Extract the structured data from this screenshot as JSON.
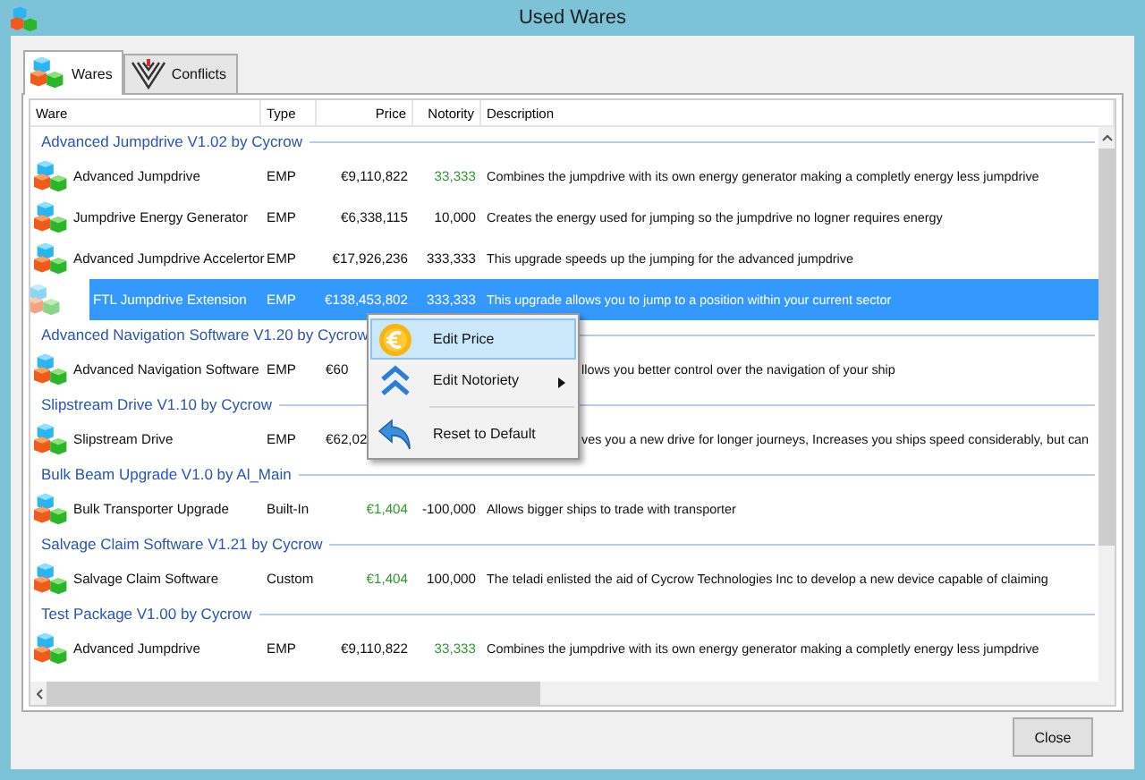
{
  "window": {
    "title": "Used Wares"
  },
  "tabs": [
    {
      "label": "Wares",
      "selected": true,
      "kind": "wares"
    },
    {
      "label": "Conflicts",
      "selected": false,
      "kind": "conflicts"
    }
  ],
  "table": {
    "columns": [
      "Ware",
      "Type",
      "Price",
      "Notority",
      "Description"
    ],
    "groups": [
      {
        "title": "Advanced Jumpdrive V1.02 by Cycrow",
        "rows": [
          {
            "ware": "Advanced Jumpdrive",
            "type": "EMP",
            "price": {
              "text": "€9,110,822"
            },
            "notoriety": {
              "text": "33,333",
              "color": "#2f9a2f"
            },
            "description": "Combines the jumpdrive with its own energy generator making a completly energy less jumpdrive",
            "selected": false
          },
          {
            "ware": "Jumpdrive Energy Generator",
            "type": "EMP",
            "price": {
              "text": "€6,338,115"
            },
            "notoriety": {
              "text": "10,000"
            },
            "description": "Creates the energy used for jumping so the jumpdrive no logner requires energy",
            "selected": false
          },
          {
            "ware": "Advanced Jumpdrive Accelertor",
            "type": "EMP",
            "price": {
              "text": "€17,926,236"
            },
            "notoriety": {
              "text": "333,333"
            },
            "description": "This upgrade speeds up the jumping for the advanced jumpdrive",
            "selected": false
          },
          {
            "ware": "FTL Jumpdrive Extension",
            "type": "EMP",
            "price": {
              "text": "€138,453,802"
            },
            "notoriety": {
              "text": "333,333"
            },
            "description": "This upgrade allows you to jump to a position within your current sector",
            "selected": true
          }
        ]
      },
      {
        "title": "Advanced Navigation Software V1.20 by Cycrow",
        "rows": [
          {
            "ware": "Advanced Navigation Software",
            "type": "EMP",
            "price": {
              "text": "€60"
            },
            "description": "llows you better control over the navigation of your ship",
            "selected": false
          }
        ]
      },
      {
        "title": "Slipstream Drive V1.10 by Cycrow",
        "rows": [
          {
            "ware": "Slipstream Drive",
            "type": "EMP",
            "price": {
              "text": "€62,02"
            },
            "description": "ves you a new drive for longer journeys, Increases you ships speed considerably, but can",
            "selected": false
          }
        ]
      },
      {
        "title": "Bulk Beam Upgrade V1.0 by Al_Main",
        "rows": [
          {
            "ware": "Bulk Transporter Upgrade",
            "type": "Built-In",
            "price": {
              "text": "€1,404",
              "color": "#2f9a2f"
            },
            "notoriety": {
              "text": "-100,000"
            },
            "description": "Allows bigger ships to trade with transporter",
            "selected": false
          }
        ]
      },
      {
        "title": "Salvage Claim Software V1.21 by Cycrow",
        "rows": [
          {
            "ware": "Salvage Claim Software",
            "type": "Custom",
            "price": {
              "text": "€1,404",
              "color": "#2f9a2f"
            },
            "notoriety": {
              "text": "100,000"
            },
            "description": "The teladi enlisted the aid of Cycrow Technologies Inc to develop a new device capable of claiming",
            "selected": false
          }
        ]
      },
      {
        "title": "Test Package V1.00 by Cycrow",
        "rows": [
          {
            "ware": "Advanced Jumpdrive",
            "type": "EMP",
            "price": {
              "text": "€9,110,822"
            },
            "notoriety": {
              "text": "33,333",
              "color": "#2f9a2f"
            },
            "description": "Combines the jumpdrive with its own energy generator making a completly energy less jumpdrive",
            "selected": false
          }
        ]
      }
    ]
  },
  "context_menu": {
    "items": [
      {
        "label": "Edit Price",
        "kind": "price",
        "selected": true,
        "submenu": false
      },
      {
        "label": "Edit Notoriety",
        "kind": "notoriety",
        "selected": false,
        "submenu": true
      },
      {
        "label": "Reset to Default",
        "kind": "reset",
        "selected": false,
        "submenu": false
      }
    ]
  },
  "buttons": [
    "Close"
  ]
}
